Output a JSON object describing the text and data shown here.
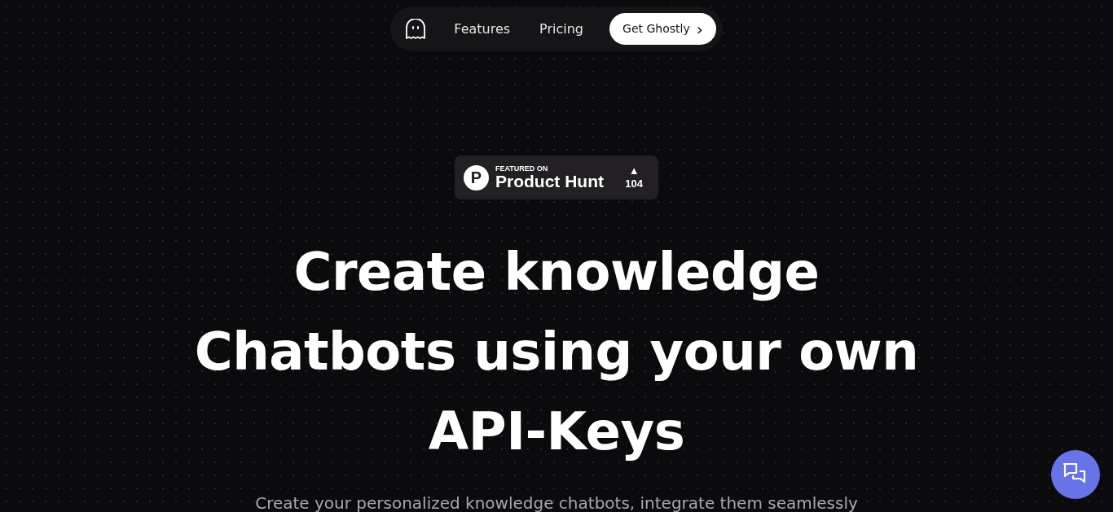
{
  "nav": {
    "links": [
      {
        "label": "Features"
      },
      {
        "label": "Pricing"
      }
    ],
    "cta": {
      "label": "Get Ghostly",
      "icon": "›"
    }
  },
  "badge": {
    "logo_letter": "P",
    "kicker": "FEATURED ON",
    "name": "Product Hunt",
    "arrow": "▲",
    "votes": "104"
  },
  "hero": {
    "title_lines": [
      "Create knowledge",
      "Chatbots using your own",
      "API-Keys"
    ],
    "subtitle": "Create your personalized knowledge chatbots, integrate them seamlessly"
  }
}
